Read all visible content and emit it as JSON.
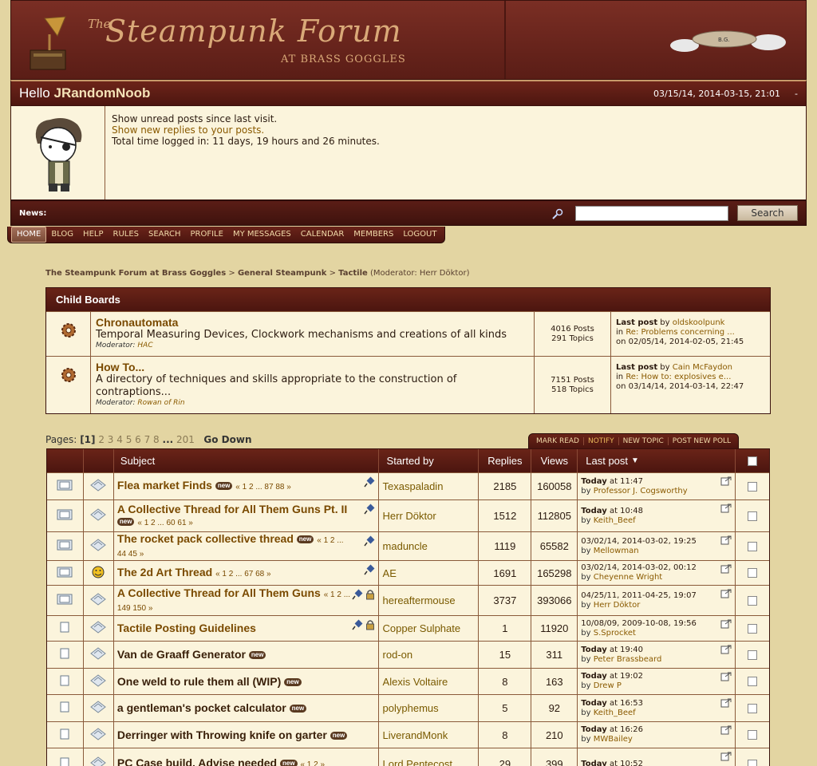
{
  "header": {
    "title_the": "The",
    "title_main": "Steampunk Forum",
    "title_sub": "AT BRASS GOGGLES",
    "airship_label": "B.G."
  },
  "user": {
    "greeting": "Hello",
    "name": "JRandomNoob",
    "date": "03/15/14, 2014-03-15, 21:01",
    "collapse": "-",
    "unread": "Show unread posts since last visit.",
    "replies": "Show new replies to your posts.",
    "time": "Total time logged in: 11 days, 19 hours and 26 minutes."
  },
  "news": {
    "label": "News:",
    "search_button": "Search",
    "search_value": ""
  },
  "menu": [
    "HOME",
    "BLOG",
    "HELP",
    "RULES",
    "SEARCH",
    "PROFILE",
    "MY MESSAGES",
    "CALENDAR",
    "MEMBERS",
    "LOGOUT"
  ],
  "breadcrumb": {
    "forum": "The Steampunk Forum at Brass Goggles",
    "sep": ">",
    "category": "General Steampunk",
    "board": "Tactile",
    "moderator": "(Moderator: Herr Döktor)"
  },
  "child_boards": {
    "title": "Child Boards",
    "boards": [
      {
        "name": "Chronautomata",
        "desc": "Temporal Measuring Devices, Clockwork mechanisms and creations of all kinds",
        "mod_label": "Moderator:",
        "mod": "HAC",
        "posts": "4016 Posts",
        "topics": "291 Topics",
        "lp_label": "Last post",
        "lp_by": "by",
        "lp_user": "oldskoolpunk",
        "lp_in": "in",
        "lp_topic": "Re: Problems concerning ...",
        "lp_on": "on 02/05/14, 2014-02-05, 21:45"
      },
      {
        "name": "How To...",
        "desc": "A directory of techniques and skills appropriate to the construction of contraptions...",
        "mod_label": "Moderator:",
        "mod": "Rowan of Rin",
        "posts": "7151 Posts",
        "topics": "518 Topics",
        "lp_label": "Last post",
        "lp_by": "by",
        "lp_user": "Cain McFaydon",
        "lp_in": "in",
        "lp_topic": "Re: How to: explosives e...",
        "lp_on": "on 03/14/14, 2014-03-14, 22:47"
      }
    ]
  },
  "pages": {
    "label": "Pages:",
    "current": "[1]",
    "list": "2 3 4 5 6 7 8",
    "dots": "...",
    "last": "201",
    "go_down": "Go Down"
  },
  "board_buttons": [
    "MARK READ",
    "NOTIFY",
    "NEW TOPIC",
    "POST NEW POLL"
  ],
  "table": {
    "headers": {
      "subject": "Subject",
      "started_by": "Started by",
      "replies": "Replies",
      "views": "Views",
      "last_post": "Last post"
    },
    "new_badge": "new",
    "rows": [
      {
        "subject": "Flea market Finds",
        "pages": "« 1 2 ... 87 88 »",
        "starter": "Texaspaladin",
        "replies": "2185",
        "views": "160058",
        "lp1": "Today",
        "lp1b": "at 11:47",
        "lp_user": "Professor J. Cogsworthy"
      },
      {
        "subject": "A Collective Thread for All Them Guns Pt. II",
        "pages": "« 1 2 ... 60 61 »",
        "starter": "Herr Döktor",
        "replies": "1512",
        "views": "112805",
        "lp1": "Today",
        "lp1b": "at 10:48",
        "lp_user": "Keith_Beef"
      },
      {
        "subject": "The rocket pack collective thread",
        "pages": "« 1 2 ... 44 45 »",
        "starter": "maduncle",
        "replies": "1119",
        "views": "65582",
        "lp1": "",
        "lp1b": "03/02/14, 2014-03-02, 19:25",
        "lp_user": "Mellowman"
      },
      {
        "subject": "The 2d Art Thread",
        "pages": "« 1 2 ... 67 68 »",
        "starter": "AE",
        "replies": "1691",
        "views": "165298",
        "lp1": "",
        "lp1b": "03/02/14, 2014-03-02, 00:12",
        "lp_user": "Cheyenne Wright"
      },
      {
        "subject": "A Collective Thread for All Them Guns",
        "pages": "« 1 2 ... 149 150 »",
        "starter": "hereaftermouse",
        "replies": "3737",
        "views": "393066",
        "lp1": "",
        "lp1b": "04/25/11, 2011-04-25, 19:07",
        "lp_user": "Herr Döktor"
      },
      {
        "subject": "Tactile Posting Guidelines",
        "pages": "",
        "starter": "Copper Sulphate",
        "replies": "1",
        "views": "11920",
        "lp1": "",
        "lp1b": "10/08/09, 2009-10-08, 19:56",
        "lp_user": "S.Sprocket"
      },
      {
        "subject": "Van de Graaff Generator",
        "pages": "",
        "starter": "rod-on",
        "replies": "15",
        "views": "311",
        "lp1": "Today",
        "lp1b": "at 19:40",
        "lp_user": "Peter Brassbeard"
      },
      {
        "subject": "One weld to rule them all (WIP)",
        "pages": "",
        "starter": "Alexis Voltaire",
        "replies": "8",
        "views": "163",
        "lp1": "Today",
        "lp1b": "at 19:02",
        "lp_user": "Drew P"
      },
      {
        "subject": "a gentleman's pocket calculator",
        "pages": "",
        "starter": "polyphemus",
        "replies": "5",
        "views": "92",
        "lp1": "Today",
        "lp1b": "at 16:53",
        "lp_user": "Keith_Beef"
      },
      {
        "subject": "Derringer with Throwing knife on garter",
        "pages": "",
        "starter": "LiverandMonk",
        "replies": "8",
        "views": "210",
        "lp1": "Today",
        "lp1b": "at 16:26",
        "lp_user": "MWBailey"
      },
      {
        "subject": "PC Case build. Advise needed",
        "pages": "« 1 2 »",
        "starter": "Lord Pentecost",
        "replies": "29",
        "views": "399",
        "lp1": "Today",
        "lp1b": "at 10:52",
        "lp_user": ""
      }
    ],
    "by_label": "by"
  }
}
